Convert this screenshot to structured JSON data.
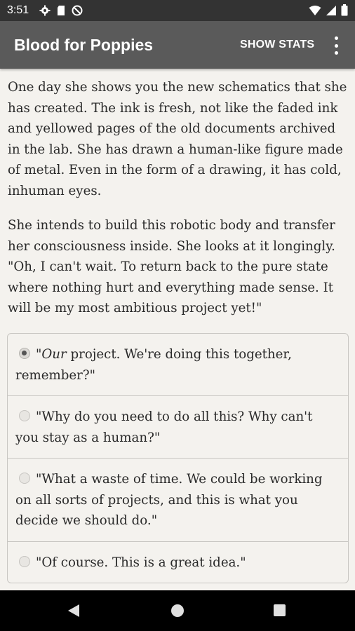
{
  "status_bar": {
    "time": "3:51",
    "left_icons": [
      "gear-icon",
      "sd-card-icon",
      "no-disturb-icon"
    ],
    "right_icons": [
      "wifi-icon",
      "cellular-icon",
      "battery-icon"
    ]
  },
  "app_bar": {
    "title": "Blood for Poppies",
    "show_stats_label": "SHOW STATS",
    "overflow_icon": "more-vert-icon"
  },
  "story": {
    "paragraphs": [
      "One day she shows you the new schematics that she has created. The ink is fresh, not like the faded ink and yellowed pages of the old documents archived in the lab. She has drawn a human-like figure made of metal. Even in the form of a drawing, it has cold, inhuman eyes.",
      "She intends to build this robotic body and transfer her consciousness inside. She looks at it longingly. \"Oh, I can't wait. To return back to the pure state where nothing hurt and everything made sense. It will be my most ambitious project yet!\""
    ]
  },
  "choices": [
    {
      "open_quote": "\"",
      "emphasis": "Our",
      "rest": " project. We're doing this together, remember?\"",
      "selected": true
    },
    {
      "text": "\"Why do you need to do all this? Why can't you stay as a human?\"",
      "selected": false
    },
    {
      "text": "\"What a waste of time. We could be working on all sorts of projects, and this is what you decide we should do.\"",
      "selected": false
    },
    {
      "text": "\"Of course. This is a great idea.\"",
      "selected": false
    }
  ],
  "nav_bar": {
    "icons": [
      "back-icon",
      "home-icon",
      "recents-icon"
    ]
  },
  "colors": {
    "status_bar_bg": "#333333",
    "app_bar_bg": "#5a5a5a",
    "page_bg": "#f4f2ee",
    "nav_bar_bg": "#000000"
  }
}
